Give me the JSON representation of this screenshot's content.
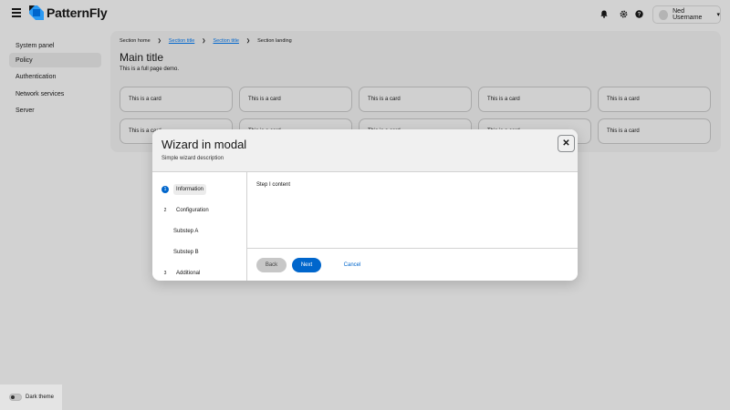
{
  "masthead": {
    "brand": "PatternFly",
    "user_name": "Ned Username",
    "icons": [
      "bell-icon",
      "gear-icon",
      "help-icon"
    ]
  },
  "sidebar": {
    "items": [
      {
        "label": "System panel",
        "active": false
      },
      {
        "label": "Policy",
        "active": true
      },
      {
        "label": "Authentication",
        "active": false
      },
      {
        "label": "Network services",
        "active": false
      },
      {
        "label": "Server",
        "active": false
      }
    ]
  },
  "main": {
    "breadcrumb": [
      "Section home",
      "Section title",
      "Section title",
      "Section landing"
    ],
    "title": "Main title",
    "description": "This is a full page demo.",
    "card_text": "This is a card",
    "card_count": 10
  },
  "modal": {
    "title": "Wizard in modal",
    "description": "Simple wizard description",
    "steps": [
      {
        "number": "1",
        "label": "Information",
        "current": true
      },
      {
        "number": "2",
        "label": "Configuration",
        "current": false
      },
      {
        "number": "",
        "label": "Substep A",
        "current": false
      },
      {
        "number": "",
        "label": "Substep B",
        "current": false
      },
      {
        "number": "3",
        "label": "Additional",
        "current": false
      }
    ],
    "body": "Step I content",
    "back_label": "Back",
    "next_label": "Next",
    "cancel_label": "Cancel"
  },
  "theme": {
    "label": "Dark theme",
    "enabled": false
  },
  "colors": {
    "accent": "#0066cc",
    "backdrop": "#d2d2d2"
  }
}
